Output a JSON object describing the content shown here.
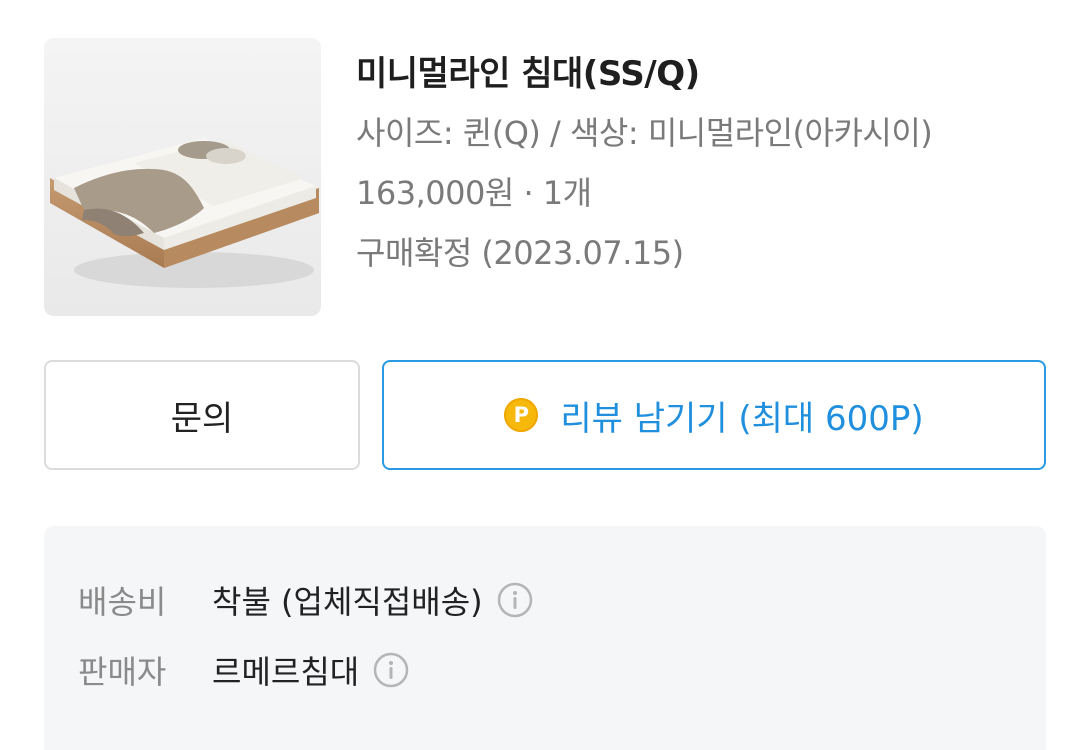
{
  "product": {
    "image_alt": "bed-photo",
    "title": "미니멀라인 침대(SS/Q)",
    "options": "사이즈: 퀸(Q) / 색상: 미니멀라인(아카시이)",
    "price_qty": "163,000원 · 1개",
    "status": "구매확정 (2023.07.15)"
  },
  "actions": {
    "inquiry_label": "문의",
    "review_icon_letter": "P",
    "review_label": "리뷰 남기기 (최대 600P)"
  },
  "delivery_info": {
    "shipping_label": "배송비",
    "shipping_value": "착불 (업체직접배송)",
    "seller_label": "판매자",
    "seller_value": "르메르침대"
  },
  "colors": {
    "accent": "#1f8fde",
    "coin": "#f7b80c",
    "panel_bg": "#f4f6f8"
  },
  "icons": [
    "info-icon",
    "point-coin-icon"
  ]
}
